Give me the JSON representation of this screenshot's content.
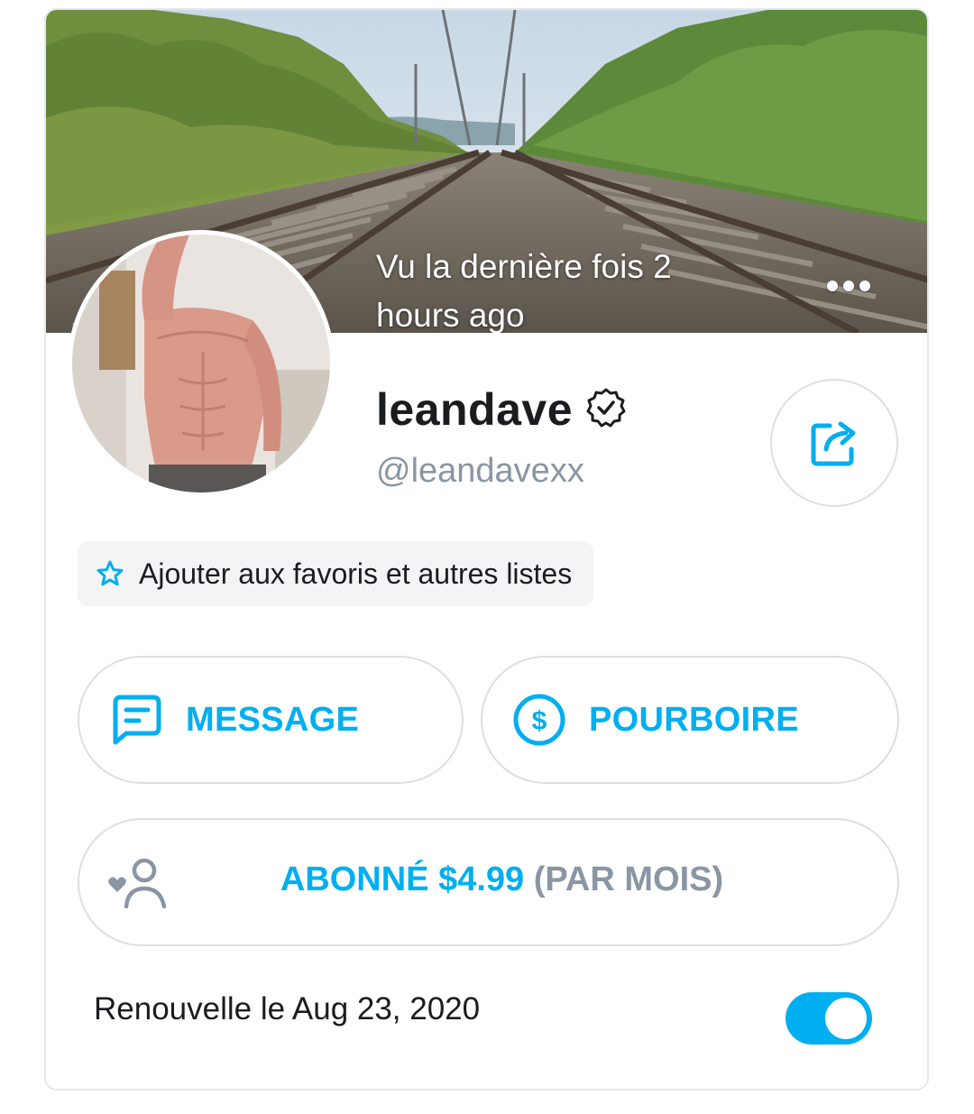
{
  "profile": {
    "last_seen": "Vu la dernière fois 2 hours ago",
    "display_name": "leandave",
    "handle": "@leandavexx",
    "verified": true
  },
  "icons": {
    "verified": "verified-badge-icon",
    "more": "more-horizontal-icon",
    "share": "share-icon",
    "favorites": "star-icon",
    "message": "message-icon",
    "tip": "dollar-circle-icon",
    "subscribe": "user-heart-icon"
  },
  "favorites_chip": {
    "label": "Ajouter aux favoris et autres listes"
  },
  "actions": {
    "message_label": "MESSAGE",
    "tip_label": "POURBOIRE",
    "subscribe_label": "ABONNÉ $4.99",
    "subscribe_period": "(PAR MOIS)"
  },
  "renewal": {
    "text": "Renouvelle le Aug 23, 2020",
    "auto_renew_enabled": true
  },
  "colors": {
    "accent": "#00aff0",
    "muted_text": "#8a96a3",
    "text": "#1a1c1f",
    "border": "#dcdfe3"
  }
}
